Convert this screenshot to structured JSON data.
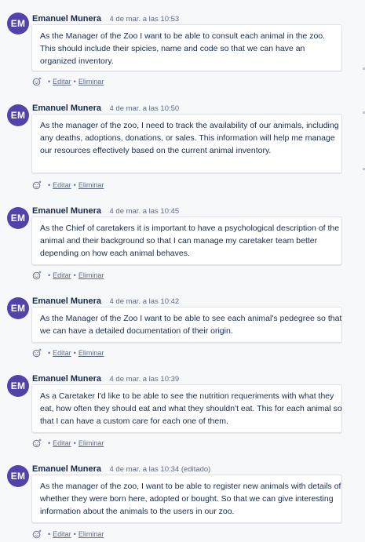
{
  "actions": {
    "edit": "Editar",
    "separator": "•",
    "delete": "Eliminar"
  },
  "comments": [
    {
      "initials": "EM",
      "author": "Emanuel Munera",
      "timestamp": "4 de mar. a las 10:53",
      "text": "As the Manager of the Zoo I want to be able to consult each animal in the zoo. This should include their spicies, name and code so that we can have an organized inventory."
    },
    {
      "initials": "EM",
      "author": "Emanuel Munera",
      "timestamp": "4 de mar. a las 10:50",
      "text": "As the manager of the zoo, I need to track the availability of our animals, including any deaths, adoptions, donations, or sales. This information will help me manage our resources effectively based on the current animal inventory."
    },
    {
      "initials": "EM",
      "author": "Emanuel Munera",
      "timestamp": "4 de mar. a las 10:45",
      "text": "As the Chief of caretakers it is important to have a psychological description of the animal and their background so that I can manage my caretaker team better depending on how each animal behaves."
    },
    {
      "initials": "EM",
      "author": "Emanuel Munera",
      "timestamp": "4 de mar. a las 10:42",
      "text": "As the Manager of the Zoo I want to be able to see each animal's pedegree so that we can have a detailed documentation of their origin."
    },
    {
      "initials": "EM",
      "author": "Emanuel Munera",
      "timestamp": "4 de mar. a las 10:39",
      "text": "As a Caretaker I'd like to be able to see the nutrition requeriments with what they eat, how often they should eat and what they shouldn't eat. This for each animal so that I can have a custom care for each one of them."
    },
    {
      "initials": "EM",
      "author": "Emanuel Munera",
      "timestamp": "4 de mar. a las 10:34 (editado)",
      "text": "As the manager of the zoo, I want to be able to register new animals with details of whether they were born here, adopted or bought. So that we can give interesting information about the animals to the users in our zoo."
    }
  ]
}
